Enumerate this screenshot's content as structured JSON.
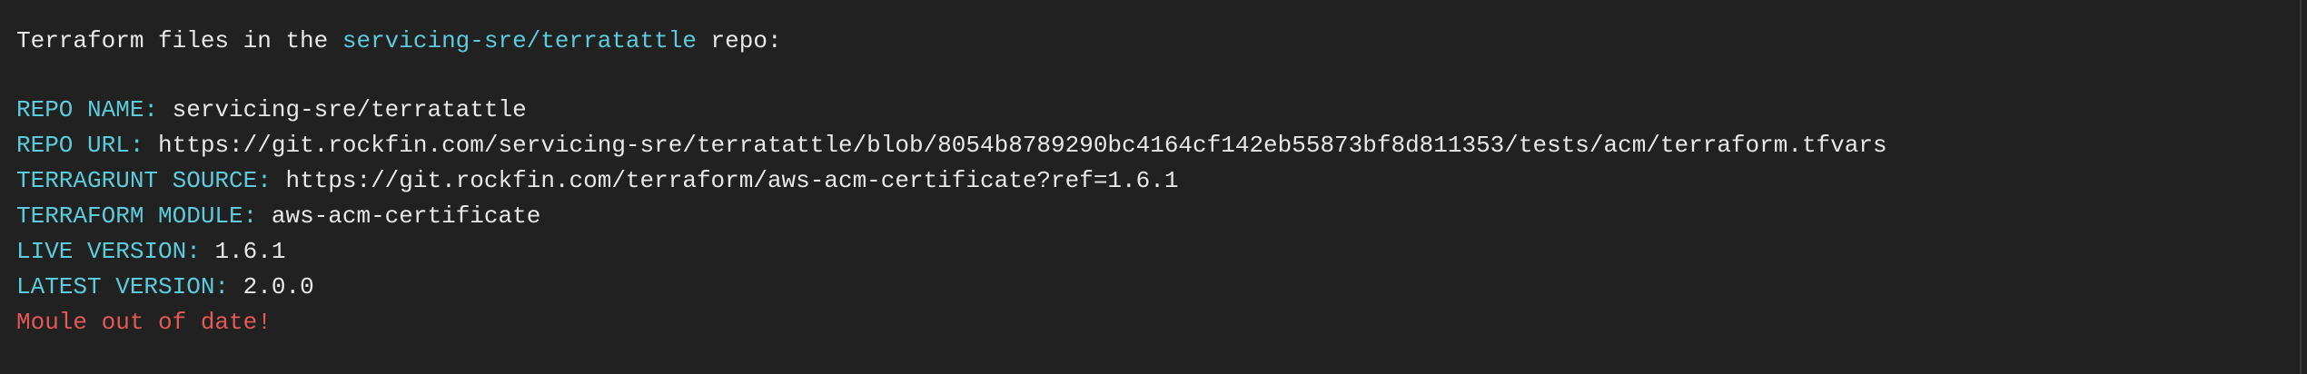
{
  "header": {
    "prefix": "Terraform files in the ",
    "repo": "servicing-sre/terratattle",
    "suffix": " repo:"
  },
  "fields": [
    {
      "label": "REPO NAME:",
      "value": "servicing-sre/terratattle"
    },
    {
      "label": "REPO URL:",
      "value": "https://git.rockfin.com/servicing-sre/terratattle/blob/8054b8789290bc4164cf142eb55873bf8d811353/tests/acm/terraform.tfvars"
    },
    {
      "label": "TERRAGRUNT SOURCE:",
      "value": "https://git.rockfin.com/terraform/aws-acm-certificate?ref=1.6.1"
    },
    {
      "label": "TERRAFORM MODULE:",
      "value": "aws-acm-certificate"
    },
    {
      "label": "LIVE VERSION:",
      "value": "1.6.1"
    },
    {
      "label": "LATEST VERSION:",
      "value": "2.0.0"
    }
  ],
  "warning": "Moule out of date!",
  "colors": {
    "background": "#212121",
    "text": "#e8e8e8",
    "key": "#5ccbdc",
    "warning": "#e45858"
  }
}
